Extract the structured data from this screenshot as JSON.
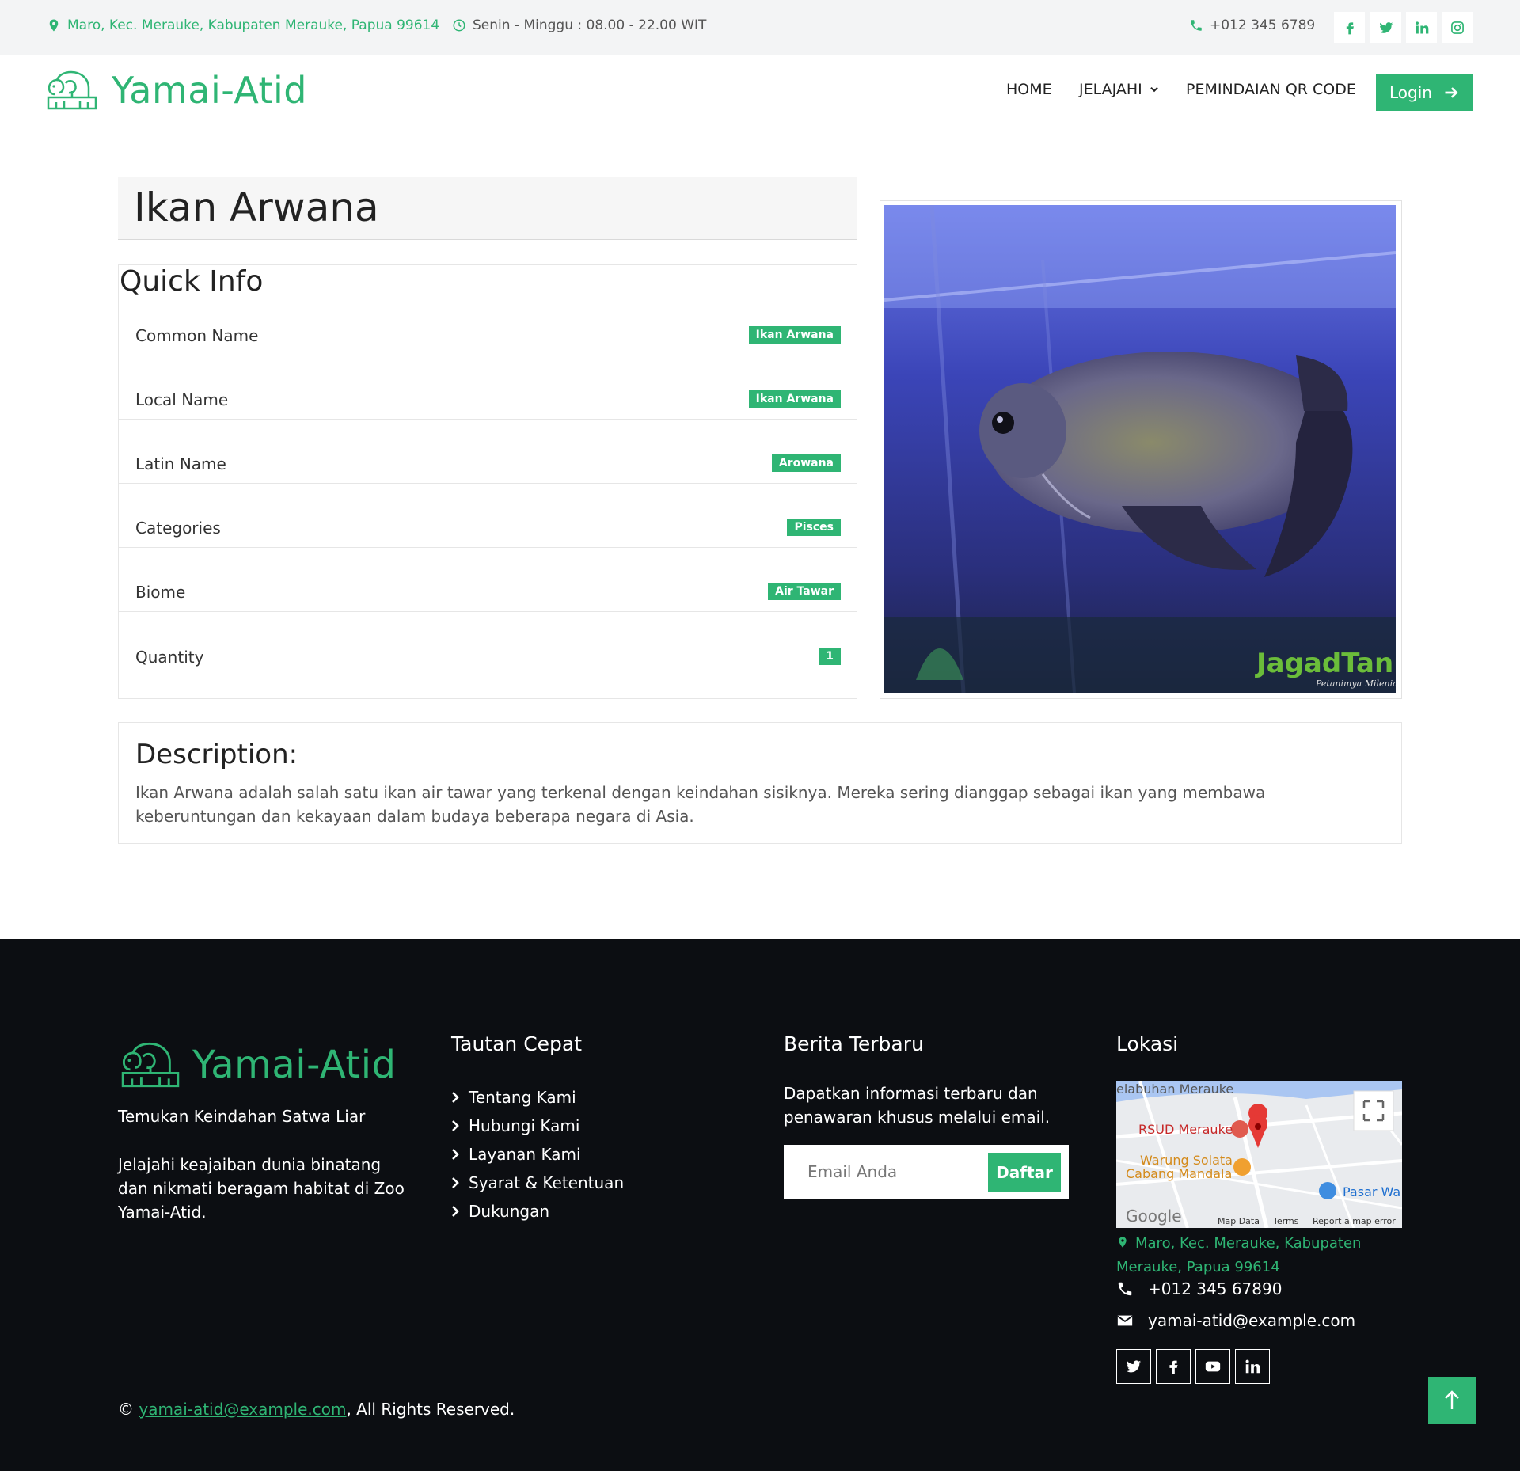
{
  "topbar": {
    "address": "Maro, Kec. Merauke, Kabupaten Merauke, Papua 99614",
    "hours": "Senin - Minggu : 08.00 - 22.00 WIT",
    "phone": "+012 345 6789"
  },
  "brand": {
    "name": "Yamai-Atid"
  },
  "nav": {
    "home": "HOME",
    "explore": "JELAJAHI",
    "qr": "PEMINDAIAN QR CODE",
    "login": "Login"
  },
  "animal": {
    "title": "Ikan Arwana",
    "quick_info_heading": "Quick Info",
    "info": [
      {
        "label": "Common Name",
        "value": "Ikan Arwana"
      },
      {
        "label": "Local Name",
        "value": "Ikan Arwana"
      },
      {
        "label": "Latin Name",
        "value": "Arowana"
      },
      {
        "label": "Categories",
        "value": "Pisces"
      },
      {
        "label": "Biome",
        "value": "Air Tawar"
      },
      {
        "label": "Quantity",
        "value": "1"
      }
    ],
    "description_heading": "Description:",
    "description": "Ikan Arwana adalah salah satu ikan air tawar yang terkenal dengan keindahan sisiknya. Mereka sering dianggap sebagai ikan yang membawa keberuntungan dan kekayaan dalam budaya beberapa negara di Asia.",
    "photo_watermark": "JagadTani",
    "photo_watermark_sub": "Petanimya Milenial"
  },
  "footer": {
    "tagline": "Temukan Keindahan Satwa Liar",
    "about": "Jelajahi keajaiban dunia binatang dan nikmati beragam habitat di Zoo Yamai-Atid.",
    "links_heading": "Tautan Cepat",
    "links": [
      "Tentang Kami",
      "Hubungi Kami",
      "Layanan Kami",
      "Syarat & Ketentuan",
      "Dukungan"
    ],
    "news_heading": "Berita Terbaru",
    "news_text": "Dapatkan informasi terbaru dan penawaran khusus melalui email.",
    "email_placeholder": "Email Anda",
    "subscribe": "Daftar",
    "location_heading": "Lokasi",
    "map_labels": {
      "harbor": "elabuhan Merauke",
      "hospital": "RSUD Merauke",
      "warung1": "Warung Solata",
      "warung2": "Cabang Mandala",
      "pasar": "Pasar Wa",
      "google": "Google",
      "map_data": "Map Data",
      "terms": "Terms",
      "report": "Report a map error"
    },
    "address": "Maro, Kec. Merauke, Kabupaten Merauke, Papua 99614",
    "phone": "+012 345 67890",
    "email": "yamai-atid@example.com",
    "copyright_prefix": "©",
    "copyright_link": "yamai-atid@example.com",
    "copyright_suffix": ", All Rights Reserved."
  },
  "colors": {
    "accent": "#2fb574",
    "footer_bg": "#0c0e12",
    "topbar_bg": "#f3f4f5"
  }
}
